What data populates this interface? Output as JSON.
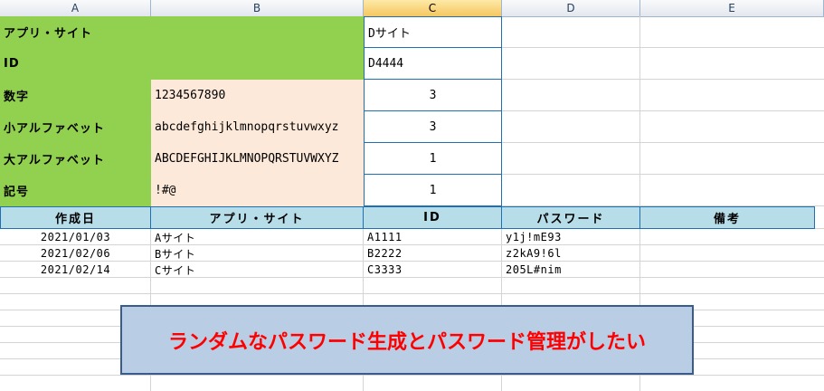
{
  "columns": [
    "A",
    "B",
    "C",
    "D",
    "E"
  ],
  "settings": {
    "app_site_label": "アプリ・サイト",
    "app_site_value": "Dサイト",
    "id_label": "ID",
    "id_value": "D4444",
    "digits_label": "数字",
    "digits_chars": "1234567890",
    "digits_count": "3",
    "lower_label": "小アルファベット",
    "lower_chars": "abcdefghijklmnopqrstuvwxyz",
    "lower_count": "3",
    "upper_label": "大アルファベット",
    "upper_chars": "ABCDEFGHIJKLMNOPQRSTUVWXYZ",
    "upper_count": "1",
    "symbol_label": "記号",
    "symbol_chars": "!#@",
    "symbol_count": "1"
  },
  "table": {
    "headers": [
      "作成日",
      "アプリ・サイト",
      "ID",
      "パスワード",
      "備考"
    ],
    "rows": [
      [
        "2021/01/03",
        "Aサイト",
        "A1111",
        "y1j!mE93",
        ""
      ],
      [
        "2021/02/06",
        "Bサイト",
        "B2222",
        "z2kA9!6l",
        ""
      ],
      [
        "2021/02/14",
        "Cサイト",
        "C3333",
        "205L#nim",
        ""
      ]
    ]
  },
  "callout": {
    "text": "ランダムなパスワード生成とパスワード管理がしたい"
  }
}
